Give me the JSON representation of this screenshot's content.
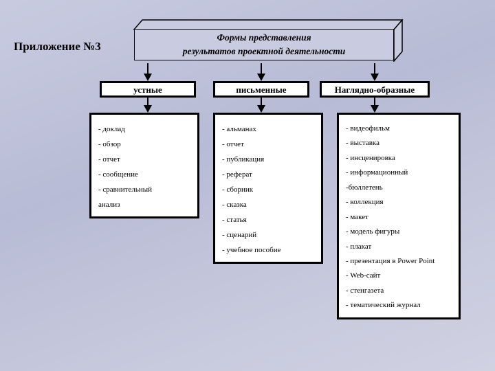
{
  "page_title": "Приложение №3",
  "main_title_line1": "Формы представления",
  "main_title_line2": "результатов проектной деятельности",
  "categories": {
    "c1": {
      "label": "устные"
    },
    "c2": {
      "label": "письменные"
    },
    "c3": {
      "label": "Наглядно-образные"
    }
  },
  "lists": {
    "l1": [
      "- доклад",
      "- обзор",
      "- отчет",
      "- сообщение",
      "- сравнительный",
      "анализ"
    ],
    "l2": [
      "- альманах",
      "- отчет",
      "- публикация",
      "- реферат",
      "- сборник",
      "- сказка",
      "- статья",
      "- сценарий",
      "- учебное пособие"
    ],
    "l3": [
      "- видеофильм",
      "- выставка",
      "- инсценировка",
      "- информационный",
      "-бюллетень",
      "- коллекция",
      "- макет",
      "- модель фигуры",
      "- плакат",
      "- презентация в Power Point",
      "- Web-сайт",
      "- стенгазета",
      "- тематический журнал"
    ]
  }
}
